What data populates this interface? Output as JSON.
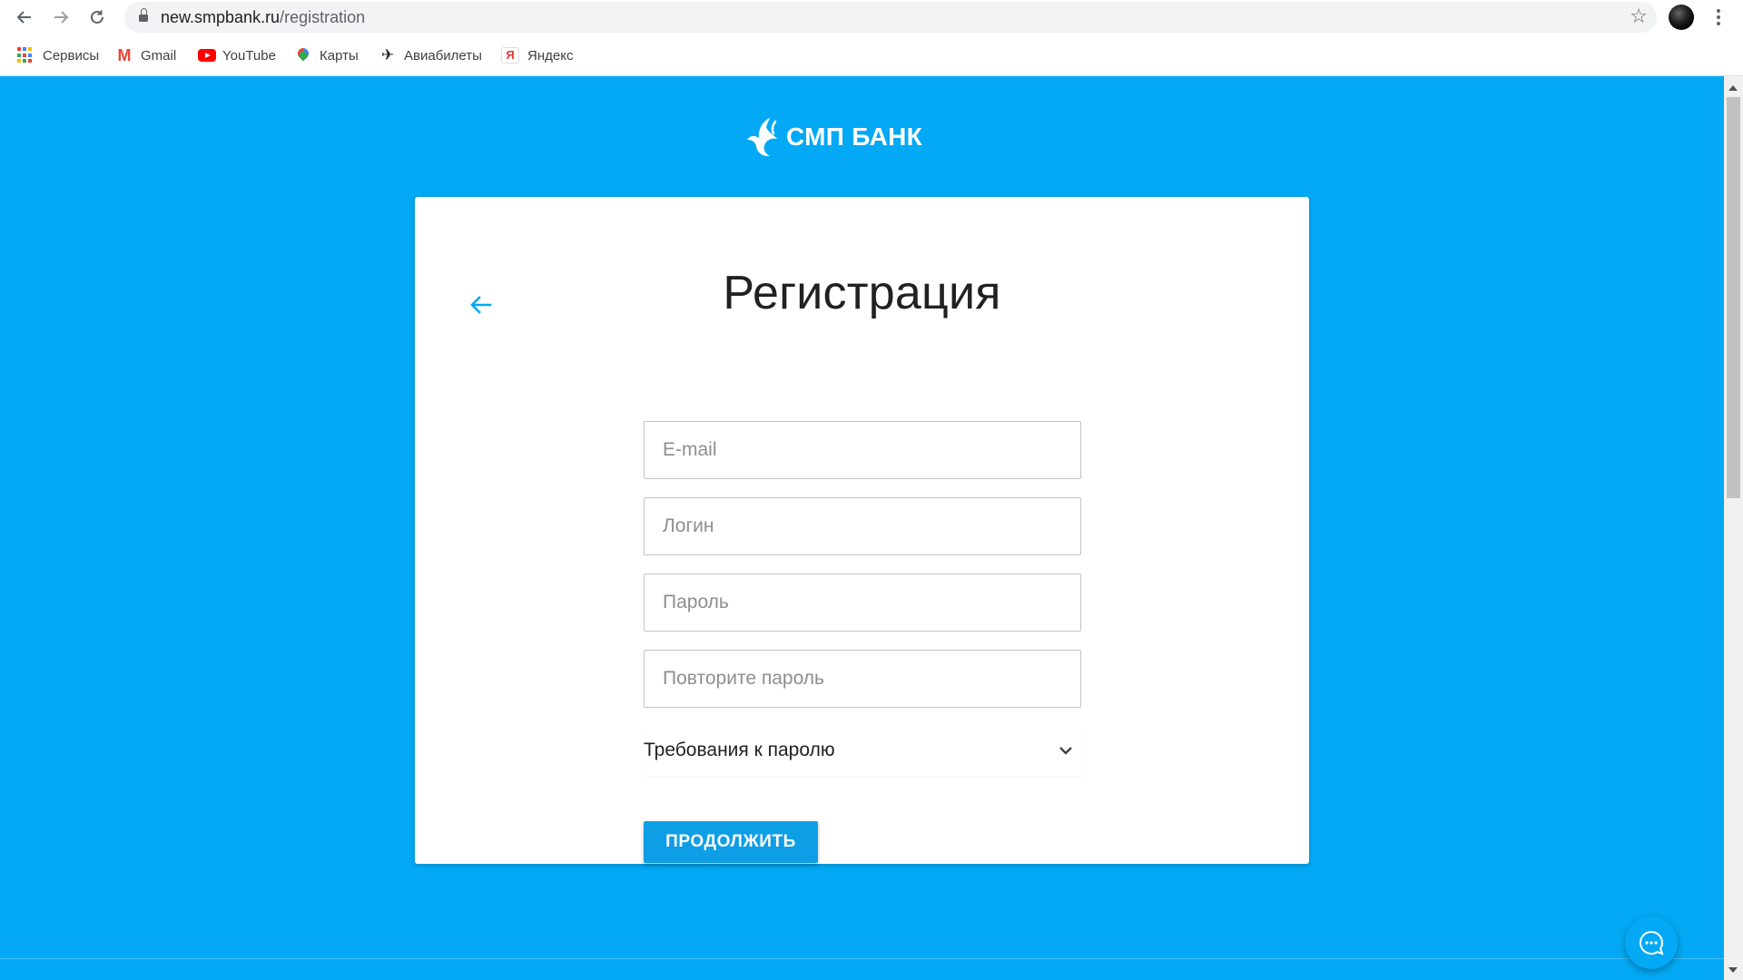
{
  "browser": {
    "url_host": "new.smpbank.ru",
    "url_path": "/registration",
    "bookmarks": [
      {
        "label": "Сервисы",
        "icon": "apps-grid-icon"
      },
      {
        "label": "Gmail",
        "icon": "gmail-icon"
      },
      {
        "label": "YouTube",
        "icon": "youtube-icon"
      },
      {
        "label": "Карты",
        "icon": "maps-pin-icon"
      },
      {
        "label": "Авиабилеты",
        "icon": "airplane-icon"
      },
      {
        "label": "Яндекс",
        "icon": "yandex-icon"
      }
    ]
  },
  "logo": {
    "text": "СМП БАНК"
  },
  "form": {
    "title": "Регистрация",
    "email_placeholder": "E-mail",
    "login_placeholder": "Логин",
    "password_placeholder": "Пароль",
    "repeat_password_placeholder": "Повторите пароль",
    "requirements_label": "Требования к паролю",
    "continue_label": "ПРОДОЛЖИТЬ"
  },
  "colors": {
    "page_background": "#03a9f4",
    "button": "#0d9ee6",
    "accent": "#03a9f4"
  }
}
